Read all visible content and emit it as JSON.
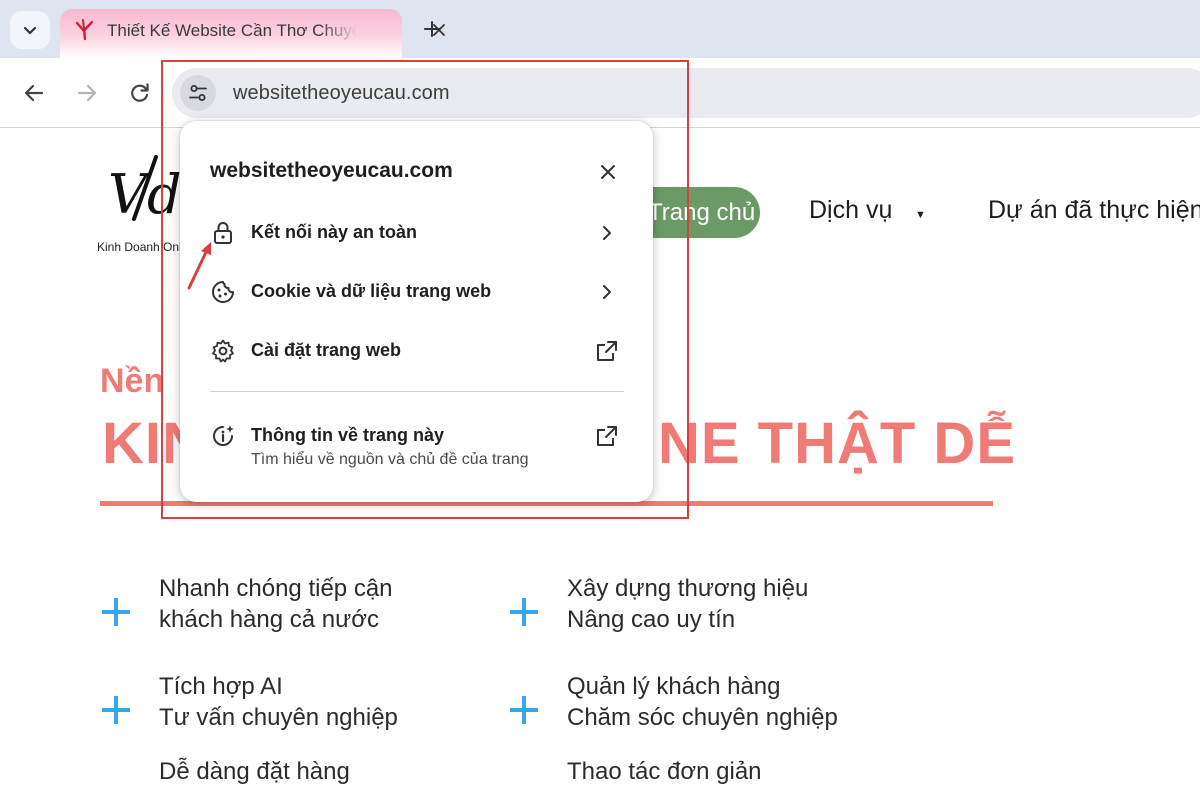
{
  "browser": {
    "tab": {
      "title": "Thiết Kế Website Cần Thơ Chuyên Nghiệp"
    },
    "address_bar": {
      "url": "websitetheoyeucau.com"
    }
  },
  "page": {
    "logo": {
      "mark": "Vdes",
      "tagline": "Kinh Doanh Online"
    },
    "nav": {
      "home": "Trang chủ",
      "services": "Dịch vụ",
      "services_caret": "▼",
      "projects": "Dự án đã thực hiện"
    },
    "hero": {
      "line1": "Nền",
      "line2": "KINH DOANH ONLINE THẬT DỄ",
      "line2_left": "KIN",
      "line2_right": "NE THẬT DỄ"
    },
    "features": [
      {
        "line1": "Nhanh chóng tiếp cận",
        "line2": "khách hàng cả nước"
      },
      {
        "line1": "Xây dựng thương hiệu",
        "line2": "Nâng cao uy tín"
      },
      {
        "line1": "Tích hợp AI",
        "line2": "Tư vấn chuyên nghiệp"
      },
      {
        "line1": "Quản lý khách hàng",
        "line2": "Chăm sóc chuyên nghiệp"
      },
      {
        "line1": "Dễ dàng đặt hàng",
        "line2": ""
      },
      {
        "line1": "Thao tác đơn giản",
        "line2": ""
      }
    ]
  },
  "site_info_popup": {
    "title": "websitetheoyeucau.com",
    "rows": [
      {
        "label": "Kết nối này an toàn",
        "icon": "lock-icon",
        "right_icon": "chevron-right-icon"
      },
      {
        "label": "Cookie và dữ liệu trang web",
        "icon": "cookie-icon",
        "right_icon": "chevron-right-icon"
      },
      {
        "label": "Cài đặt trang web",
        "icon": "gear-icon",
        "right_icon": "open-external-icon"
      }
    ],
    "about": {
      "label": "Thông tin về trang này",
      "sublabel": "Tìm hiểu về nguồn và chủ đề của trang",
      "icon": "info-sparkle-icon",
      "right_icon": "open-external-icon"
    }
  },
  "colors": {
    "tab_pink": "#f7b9d0",
    "nav_green": "#6c9a66",
    "hero_coral": "#f07a76",
    "plus_blue": "#36a7e8",
    "annotation_red": "#d6403f"
  }
}
